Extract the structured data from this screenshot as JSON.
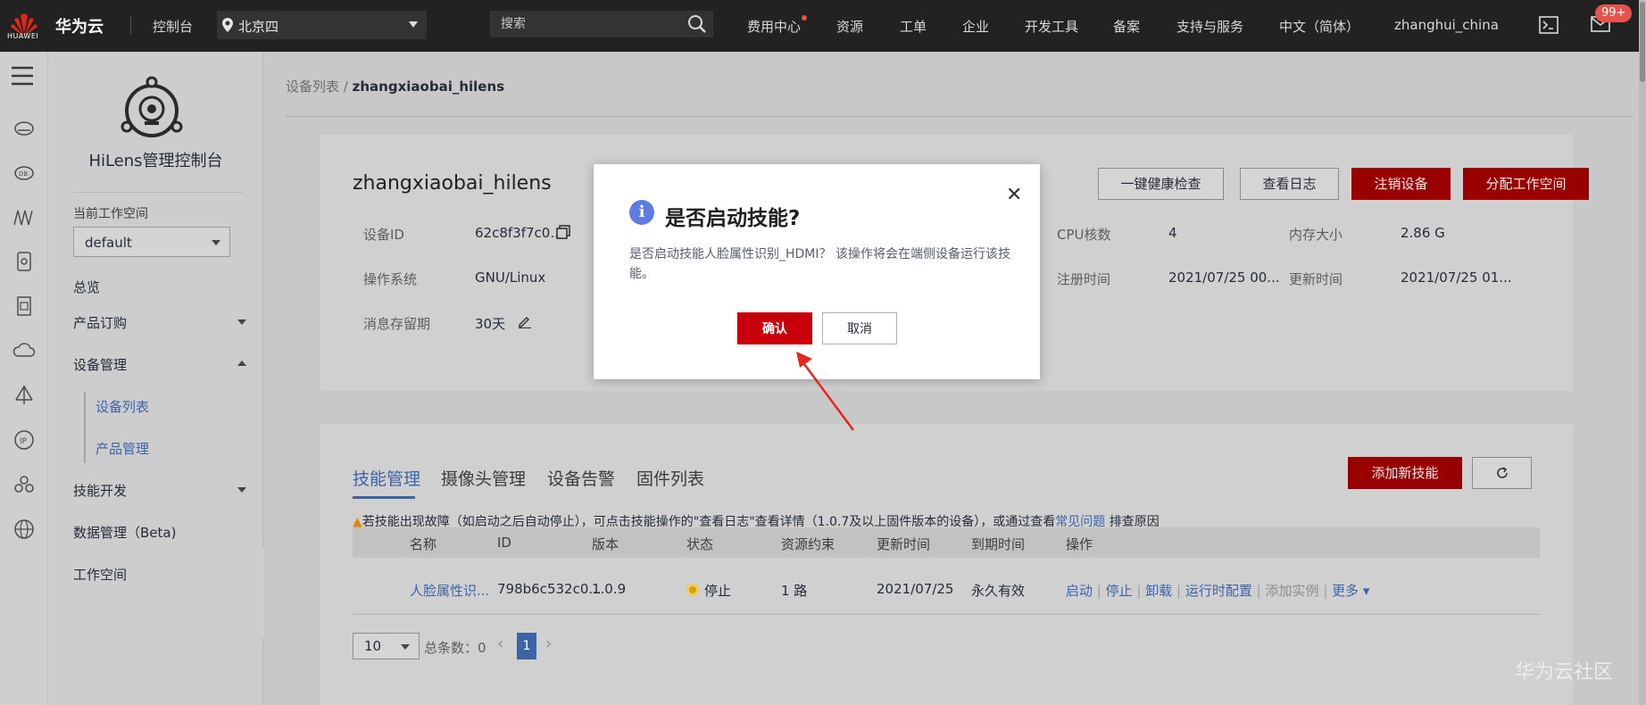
{
  "topbar": {
    "logo_text": "HUAWEI",
    "brand": "华为云",
    "console": "控制台",
    "region": "北京四",
    "search_placeholder": "搜索",
    "menu": [
      "费用中心",
      "资源",
      "工单",
      "企业",
      "开发工具",
      "备案",
      "支持与服务",
      "中文（简体）",
      "zhanghui_china"
    ],
    "badge": "99+"
  },
  "sidenav": {
    "title": "HiLens管理控制台",
    "workspace_label": "当前工作空间",
    "workspace_value": "default",
    "items": {
      "overview": "总览",
      "subscribe": "产品订购",
      "device_mgmt": "设备管理",
      "device_list": "设备列表",
      "product_mgmt": "产品管理",
      "skill_dev": "技能开发",
      "data_mgmt": "数据管理（Beta)",
      "workspace": "工作空间"
    }
  },
  "breadcrumb": {
    "parent": "设备列表",
    "sep": "/",
    "current": "zhangxiaobai_hilens"
  },
  "device": {
    "name": "zhangxiaobai_hilens",
    "buttons": {
      "health": "一键健康检查",
      "logs": "查看日志",
      "deregister": "注销设备",
      "assign": "分配工作空间"
    },
    "fields": {
      "id_label": "设备ID",
      "id_value": "62c8f3f7c0...",
      "os_label": "操作系统",
      "os_value": "GNU/Linux",
      "retention_label": "消息存留期",
      "retention_value": "30天",
      "cpu_label": "CPU核数",
      "cpu_value": "4",
      "mem_label": "内存大小",
      "mem_value": "2.86 G",
      "reg_label": "注册时间",
      "reg_value": "2021/07/25 00...",
      "upd_label": "更新时间",
      "upd_value": "2021/07/25 01..."
    }
  },
  "skills": {
    "tabs": [
      "技能管理",
      "摄像头管理",
      "设备告警",
      "固件列表"
    ],
    "add_button": "添加新技能",
    "warning_prefix": "若技能出现故障（如启动之后自动停止），可点击技能操作的\"查看日志\"查看详情（1.0.7及以上固件版本的设备），或通过查看",
    "warning_link": "常见问题",
    "warning_suffix": "排查原因",
    "columns": [
      "名称",
      "ID",
      "版本",
      "状态",
      "资源约束",
      "更新时间",
      "到期时间",
      "操作"
    ],
    "row": {
      "name": "人脸属性识...",
      "id": "798b6c532c0...",
      "version": "1.0.9",
      "status": "停止",
      "resource": "1 路",
      "updated": "2021/07/25",
      "expires": "永久有效"
    },
    "ops": [
      "启动",
      "停止",
      "卸载",
      "运行时配置",
      "添加实例",
      "更多"
    ],
    "page_size": "10",
    "total_label": "总条数：0",
    "current_page": "1"
  },
  "modal": {
    "title": "是否启动技能?",
    "body": "是否启动技能人脸属性识别_HDMI？ 该操作将会在端侧设备运行该技能。",
    "confirm": "确认",
    "cancel": "取消"
  },
  "watermark": "华为云社区",
  "colors": {
    "brand_red": "#c7000b",
    "link_blue": "#3e64a8",
    "info_blue": "#5e7ce0"
  }
}
